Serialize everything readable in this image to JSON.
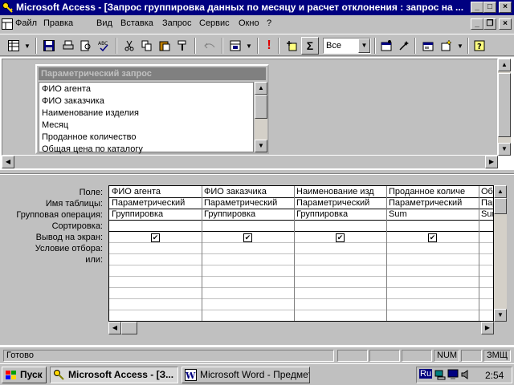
{
  "title": "Microsoft Access - [Запрос группировка данных по месяцу и расчет отклонения : запрос на ...",
  "window_buttons": {
    "min": "_",
    "max": "□",
    "close": "×"
  },
  "doc_buttons": {
    "min": "_",
    "restore": "❐",
    "close": "×"
  },
  "menu": [
    "Файл",
    "Правка",
    "Вид",
    "Вставка",
    "Запрос",
    "Сервис",
    "Окно",
    "?"
  ],
  "toolbar": {
    "sigma": "Σ",
    "run": "!",
    "topvalues": "Все"
  },
  "fieldlist": {
    "title": "Параметрический запрос",
    "items": [
      "ФИО агента",
      "ФИО заказчика",
      "Наименование изделия",
      "Месяц",
      "Проданное количество",
      "Общая цена по каталогу"
    ]
  },
  "row_labels": [
    "Поле:",
    "Имя таблицы:",
    "Групповая операция:",
    "Сортировка:",
    "Вывод на экран:",
    "Условие отбора:",
    "или:"
  ],
  "columns": [
    {
      "field": "ФИО агента",
      "table": "Параметрический",
      "group": "Группировка",
      "show": true
    },
    {
      "field": "ФИО заказчика",
      "table": "Параметрический",
      "group": "Группировка",
      "show": true
    },
    {
      "field": "Наименование изд",
      "table": "Параметрический",
      "group": "Группировка",
      "show": true
    },
    {
      "field": "Проданное количе",
      "table": "Параметрический",
      "group": "Sum",
      "show": true
    },
    {
      "field": "Общ",
      "table": "Пар",
      "group": "Sum",
      "show": true
    }
  ],
  "status": {
    "text": "Готово",
    "num": "NUM",
    "lang": "ЗМЩ"
  },
  "taskbar": {
    "start": "Пуск",
    "tasks": [
      "Microsoft Access - [З...",
      "Microsoft Word - Предмет..."
    ],
    "tray_lang": "Ru",
    "clock": "2:54"
  }
}
